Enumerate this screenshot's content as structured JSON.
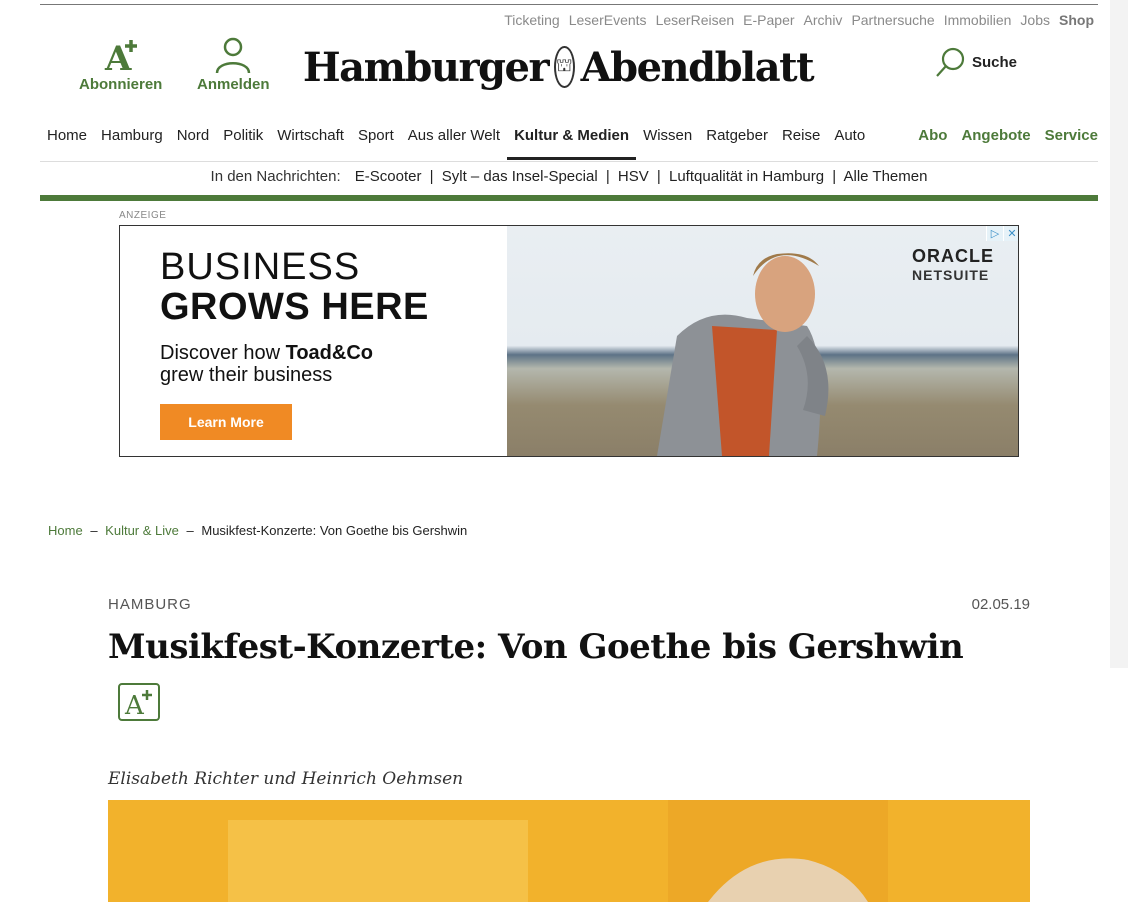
{
  "service_bar": {
    "items": [
      "Ticketing",
      "LeserEvents",
      "LeserReisen",
      "E-Paper",
      "Archiv",
      "Partnersuche",
      "Immobilien",
      "Jobs"
    ],
    "shop": "Shop"
  },
  "header": {
    "subscribe_label": "Abonnieren",
    "login_label": "Anmelden",
    "logo_left": "Hamburger",
    "logo_right": "Abendblatt",
    "search_label": "Suche"
  },
  "nav": {
    "items": [
      "Home",
      "Hamburg",
      "Nord",
      "Politik",
      "Wirtschaft",
      "Sport",
      "Aus aller Welt",
      "Kultur & Medien",
      "Wissen",
      "Ratgeber",
      "Reise",
      "Auto"
    ],
    "active": "Kultur & Medien",
    "right_items": [
      "Abo",
      "Angebote",
      "Service"
    ]
  },
  "news_ticker": {
    "label": "In den Nachrichten:",
    "links": [
      "E-Scooter",
      "Sylt – das Insel-Special",
      "HSV",
      "Luftqualität in Hamburg",
      "Alle Themen"
    ],
    "separator": "|"
  },
  "ad": {
    "label": "ANZEIGE",
    "headline_1": "BUSINESS",
    "headline_2": "GROWS HERE",
    "sub_1": "Discover how ",
    "sub_brand": "Toad&Co",
    "sub_2": "grew their business",
    "cta": "Learn More",
    "brand_1": "ORACLE",
    "brand_2": "NETSUITE"
  },
  "breadcrumb": {
    "home": "Home",
    "section": "Kultur & Live",
    "current": "Musikfest-Konzerte: Von Goethe bis Gershwin",
    "separator": "–"
  },
  "article": {
    "kicker": "HAMBURG",
    "date": "02.05.19",
    "headline": "Musikfest-Konzerte: Von Goethe bis Gershwin",
    "authors": "Elisabeth Richter und Heinrich Oehmsen"
  },
  "colors": {
    "brand_green": "#4d7a3a",
    "cta_orange": "#f08a24"
  }
}
